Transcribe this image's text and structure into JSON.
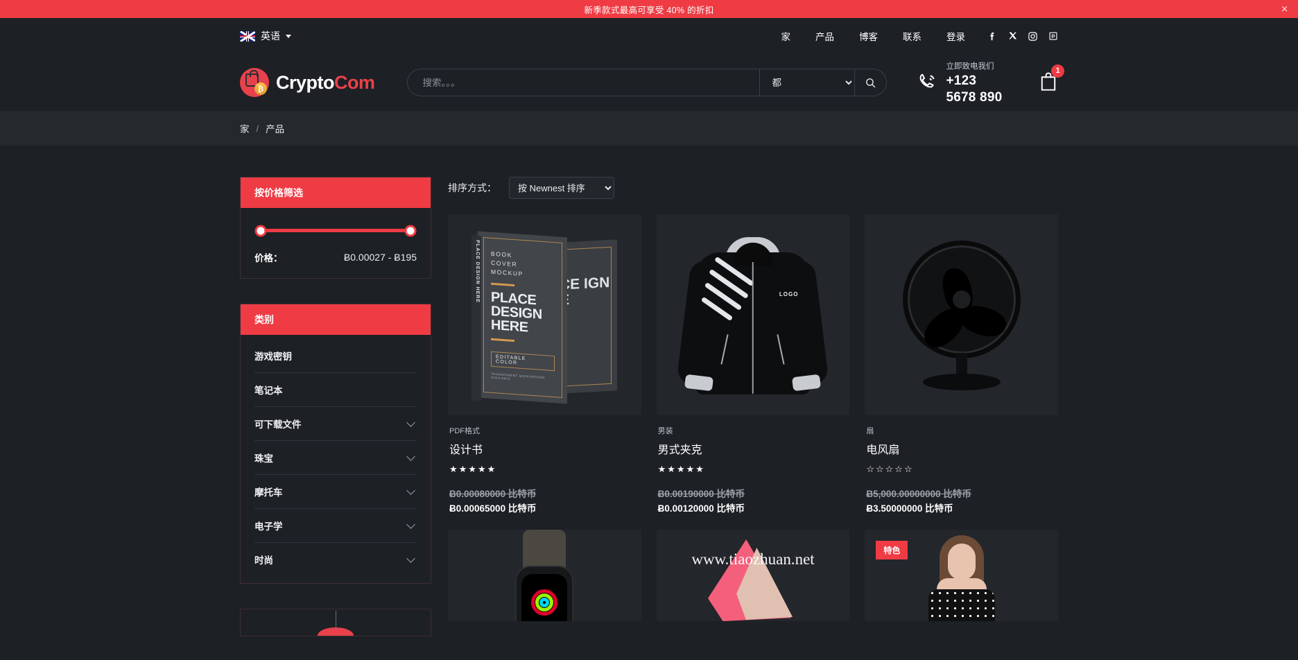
{
  "announcement": {
    "text": "新季款式最高可享受 40% 的折扣",
    "close_icon": "close-icon"
  },
  "topnav": {
    "language": {
      "label": "英语",
      "flag": "uk-flag-icon",
      "caret": "chevron-down-icon"
    },
    "links": [
      {
        "label": "家"
      },
      {
        "label": "产品"
      },
      {
        "label": "博客"
      },
      {
        "label": "联系"
      },
      {
        "label": "登录"
      }
    ],
    "socials": [
      {
        "name": "facebook-icon"
      },
      {
        "name": "x-twitter-icon"
      },
      {
        "name": "instagram-icon"
      },
      {
        "name": "pinterest-icon"
      }
    ]
  },
  "header": {
    "logo": {
      "text_primary": "Crypto",
      "text_accent": "Com",
      "coin_symbol": "₿",
      "mark": "shopping-bag-bitcoin-icon"
    },
    "search": {
      "placeholder": "搜索。。。",
      "value": "",
      "category_selected": "都",
      "category_options": [
        "都"
      ],
      "button_icon": "search-icon"
    },
    "contact": {
      "label": "立即致电我们",
      "number": "+123 5678 890",
      "icon": "phone-ring-icon"
    },
    "cart": {
      "icon": "shopping-bag-icon",
      "count": "1"
    }
  },
  "breadcrumb": {
    "items": [
      {
        "label": "家"
      },
      {
        "label": "产品"
      }
    ],
    "separator": "/"
  },
  "sidebar": {
    "price_filter": {
      "title": "按价格筛选",
      "label": "价格：",
      "range_text": "Ƀ0.00027 - Ƀ195",
      "min_pct": 0,
      "max_pct": 100
    },
    "categories": {
      "title": "类别",
      "items": [
        {
          "label": "游戏密钥",
          "expandable": false
        },
        {
          "label": "笔记本",
          "expandable": false
        },
        {
          "label": "可下载文件",
          "expandable": true
        },
        {
          "label": "珠宝",
          "expandable": true
        },
        {
          "label": "摩托车",
          "expandable": true
        },
        {
          "label": "电子学",
          "expandable": true
        },
        {
          "label": "时尚",
          "expandable": true
        }
      ]
    }
  },
  "content": {
    "sort": {
      "label": "排序方式：",
      "selected": "按 Newnest 排序",
      "options": [
        "按 Newnest 排序"
      ]
    },
    "products": [
      {
        "category": "PDF格式",
        "title": "设计书",
        "stars": "★★★★★",
        "price_old": "Ƀ0.00080000 比特币",
        "price_new": "Ƀ0.00065000 比特币",
        "image": "book-cover-mockup",
        "art": {
          "line1": "BOOK",
          "line2": "COVER",
          "line3": "MOCKUP",
          "headline": "PLACE DESIGN HERE",
          "button": "EDITABLE COLOR",
          "tiny": "TRANSPARENT BACKGROUND AVAILABLE",
          "spine": "PLACE DESIGN HERE",
          "back": "CE IGN E"
        }
      },
      {
        "category": "男装",
        "title": "男式夹克",
        "stars": "★★★★★",
        "price_old": "Ƀ0.00190000 比特币",
        "price_new": "Ƀ0.00120000 比特币",
        "image": "mens-jacket",
        "art": {
          "logo": "LOGO"
        }
      },
      {
        "category": "扇",
        "title": "电风扇",
        "stars": "☆☆☆☆☆",
        "price_old": "Ƀ5,000.00000000 比特币",
        "price_new": "Ƀ3.50000000 比特币",
        "image": "electric-fan",
        "art": {}
      },
      {
        "image": "smart-watch",
        "badge": "",
        "art": {}
      },
      {
        "image": "pink-high-heel",
        "badge": "",
        "art": {}
      },
      {
        "image": "fashion-model",
        "badge": "特色",
        "art": {}
      }
    ]
  },
  "watermark": "www.tiaozhuan.net",
  "colors": {
    "accent": "#ef3b44",
    "page_bg": "#1d2025",
    "card_bg": "#23262b",
    "crumb_bg": "#25282d",
    "text": "#ffffff",
    "muted": "#9ba1a9"
  }
}
